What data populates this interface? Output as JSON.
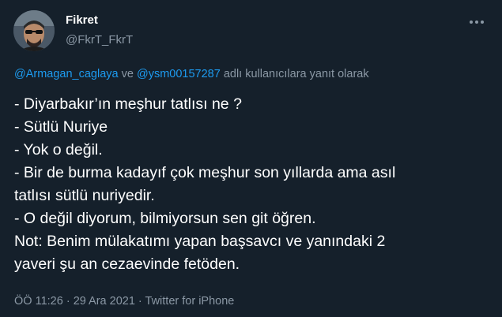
{
  "author": {
    "name": "Fikret",
    "handle": "@FkrT_FkrT"
  },
  "menu_icon": "more-horizontal-icon",
  "reply_context": {
    "mention_1": "@Armagan_caglaya",
    "connector": " ve ",
    "mention_2": "@ysm00157287",
    "suffix": " adlı kullanıcılara yanıt olarak"
  },
  "tweet_lines": [
    "- Diyarbakır’ın meşhur tatlısı ne ?",
    "- Sütlü Nuriye",
    "- Yok o değil.",
    "- Bir de burma kadayıf çok meşhur son yıllarda ama asıl",
    "tatlısı sütlü nuriyedir.",
    "- O değil diyorum, bilmiyorsun sen git öğren.",
    "Not: Benim mülakatımı yapan başsavcı ve yanındaki 2",
    "yaveri şu an cezaevinde fetöden."
  ],
  "meta": {
    "time": "ÖÖ 11:26",
    "sep1": " · ",
    "date": "29 Ara 2021",
    "sep2": " · ",
    "source": "Twitter for iPhone"
  },
  "colors": {
    "background": "#15202b",
    "text": "#ffffff",
    "secondary": "#8b98a5",
    "link": "#1d9bf0"
  }
}
